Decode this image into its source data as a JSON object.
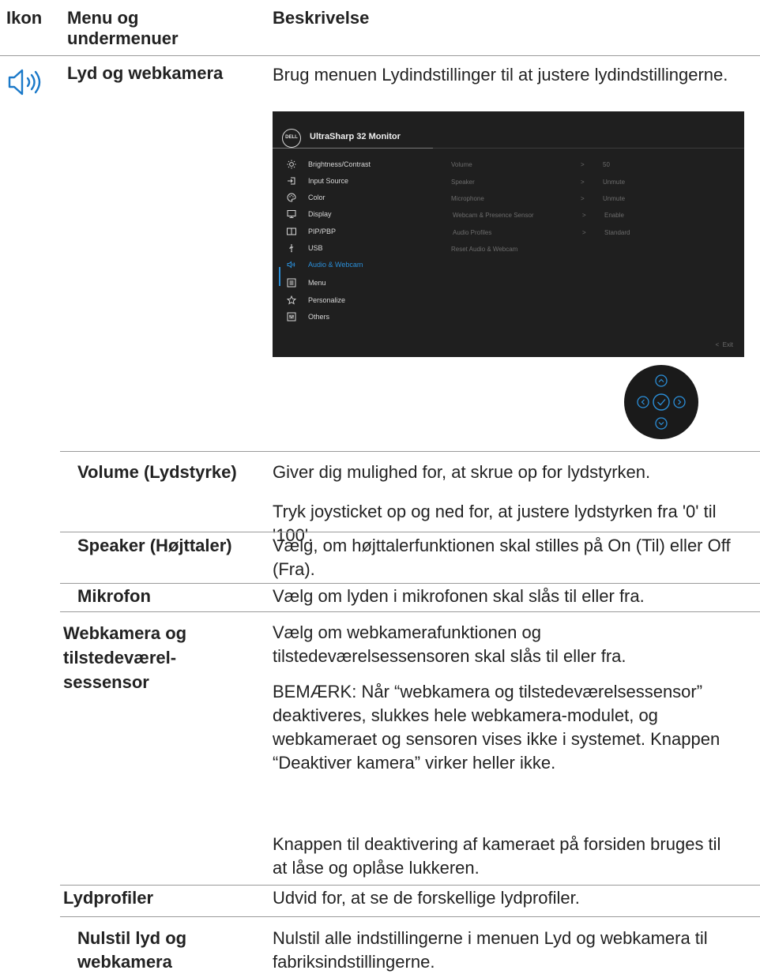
{
  "header": {
    "icon": "Ikon",
    "menu": "Menu og undermenuer",
    "desc": "Beskrivelse"
  },
  "main": {
    "icon": "speaker-icon",
    "title": "Lyd og webkamera",
    "desc": "Brug menuen Lydindstillinger til at justere lydindstillingerne."
  },
  "osd": {
    "logo": "DELL",
    "title": "UltraSharp 32 Monitor",
    "menu": [
      {
        "label": "Brightness/Contrast",
        "icon": "brightness-icon"
      },
      {
        "label": "Input Source",
        "icon": "input-source-icon"
      },
      {
        "label": "Color",
        "icon": "color-palette-icon"
      },
      {
        "label": "Display",
        "icon": "display-icon"
      },
      {
        "label": "PIP/PBP",
        "icon": "pip-pbp-icon"
      },
      {
        "label": "USB",
        "icon": "usb-icon"
      },
      {
        "label": "Audio & Webcam",
        "icon": "speaker-icon"
      },
      {
        "label": "Menu",
        "icon": "menu-icon"
      },
      {
        "label": "Personalize",
        "icon": "star-icon"
      },
      {
        "label": "Others",
        "icon": "others-icon"
      }
    ],
    "active_index": 6,
    "submenu": [
      {
        "label": "Volume",
        "value": "50"
      },
      {
        "label": "Speaker",
        "value": "Unmute"
      },
      {
        "label": "Microphone",
        "value": "Unmute"
      },
      {
        "label": "Webcam & Presence Sensor",
        "value": "Enable"
      },
      {
        "label": "Audio Profiles",
        "value": "Standard"
      },
      {
        "label": "Reset Audio & Webcam",
        "value": ""
      }
    ],
    "exit": "Exit",
    "colors": {
      "background": "#1f1f1f",
      "accent": "#2b8fd9"
    }
  },
  "rows": [
    {
      "label": "Volume (Lydstyrke)",
      "desc": [
        "Giver dig mulighed for, at skrue op for lydstyrken.",
        "Tryk joysticket op og ned for, at justere lydstyrken fra '0' til '100'."
      ]
    },
    {
      "label": "Speaker (Højttaler)",
      "desc": [
        "Vælg, om højttalerfunktionen skal stilles på On (Til) eller Off (Fra)."
      ]
    },
    {
      "label": "Mikrofon",
      "desc": [
        "Vælg om lyden i mikrofonen skal slås til eller fra."
      ]
    },
    {
      "label": "Webkamera og tilstedeværel-sessensor",
      "desc": [
        "Vælg om webkamerafunktionen og tilstedeværelsessensoren skal slås til eller fra.",
        "BEMÆRK: Når “webkamera og tilstedeværelsessensor” deaktiveres, slukkes hele webkamera-modulet, og webkameraet og sensoren vises ikke i systemet. Knappen “Deaktiver kamera” virker heller ikke.",
        "Knappen til deaktivering af kameraet på forsiden bruges til at låse og oplåse lukkeren."
      ]
    },
    {
      "label": "Lydprofiler",
      "desc": [
        "Udvid for, at se de forskellige lydprofiler."
      ]
    },
    {
      "label": "Nulstil lyd og webkamera",
      "desc": [
        "Nulstil alle indstillingerne i menuen Lyd og webkamera til fabriksindstillingerne."
      ]
    }
  ]
}
